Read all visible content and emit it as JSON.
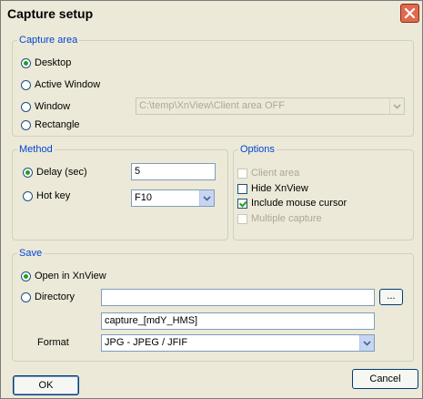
{
  "window": {
    "title": "Capture setup"
  },
  "capture_area": {
    "legend": "Capture area",
    "options": [
      {
        "label": "Desktop",
        "checked": true
      },
      {
        "label": "Active Window",
        "checked": false
      },
      {
        "label": "Window",
        "checked": false
      },
      {
        "label": "Rectangle",
        "checked": false
      }
    ],
    "window_select_value": "C:\\temp\\XnView\\Client area OFF"
  },
  "method": {
    "legend": "Method",
    "delay_label": "Delay (sec)",
    "delay_value": "5",
    "delay_checked": true,
    "hotkey_label": "Hot key",
    "hotkey_value": "F10"
  },
  "options": {
    "legend": "Options",
    "items": [
      {
        "label": "Client area",
        "checked": false,
        "enabled": false
      },
      {
        "label": "Hide XnView",
        "checked": false,
        "enabled": true
      },
      {
        "label": "Include mouse cursor",
        "checked": true,
        "enabled": true
      },
      {
        "label": "Multiple capture",
        "checked": false,
        "enabled": false
      }
    ]
  },
  "save": {
    "legend": "Save",
    "open_label": "Open in XnView",
    "open_checked": true,
    "directory_label": "Directory",
    "directory_value": "",
    "browse_label": "...",
    "filename_value": "capture_[mdY_HMS]",
    "format_label": "Format",
    "format_value": "JPG - JPEG / JFIF"
  },
  "buttons": {
    "ok": "OK",
    "cancel": "Cancel"
  },
  "colors": {
    "legend": "#0046d5",
    "close_button": "#e06a4d",
    "accent_check": "#21a121"
  }
}
